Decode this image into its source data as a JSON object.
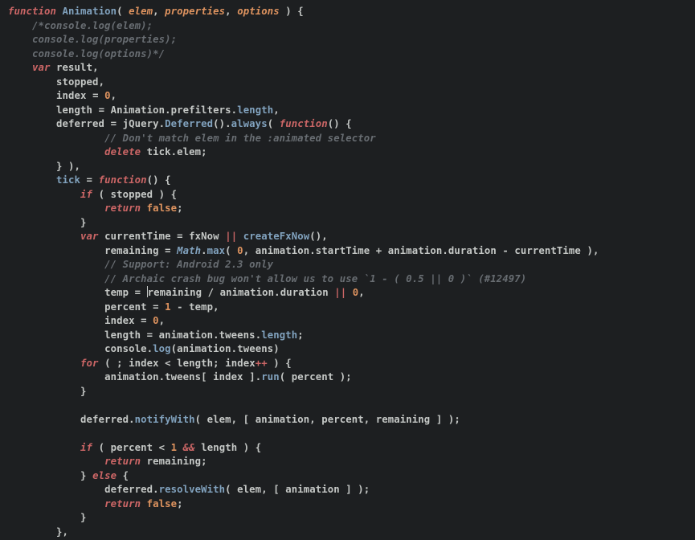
{
  "theme": {
    "background": "#1d1f21",
    "foreground": "#c5c8c6",
    "keyword": "#cc6666",
    "definition": "#81a2be",
    "param": "#de935f",
    "number": "#de935f",
    "comment": "#686d72",
    "builtin": "#81a2be"
  },
  "cursor": {
    "line": 23,
    "column_after_text": "temp = "
  },
  "code_lines": [
    {
      "n": 1,
      "tokens": [
        [
          "kw",
          "function"
        ],
        [
          "punc",
          " "
        ],
        [
          "def",
          "Animation"
        ],
        [
          "punc",
          "( "
        ],
        [
          "param",
          "elem"
        ],
        [
          "punc",
          ", "
        ],
        [
          "param",
          "properties"
        ],
        [
          "punc",
          ", "
        ],
        [
          "param",
          "options"
        ],
        [
          "punc",
          " ) {"
        ]
      ]
    },
    {
      "n": 2,
      "indent": 1,
      "tokens": [
        [
          "comment",
          "/*console.log(elem);"
        ]
      ]
    },
    {
      "n": 3,
      "indent": 1,
      "tokens": [
        [
          "comment",
          "console.log(properties);"
        ]
      ]
    },
    {
      "n": 4,
      "indent": 1,
      "tokens": [
        [
          "comment",
          "console.log(options)*/"
        ]
      ]
    },
    {
      "n": 5,
      "indent": 1,
      "tokens": [
        [
          "kw",
          "var"
        ],
        [
          "punc",
          " "
        ],
        [
          "ident",
          "result"
        ],
        [
          "punc",
          ","
        ]
      ]
    },
    {
      "n": 6,
      "indent": 2,
      "tokens": [
        [
          "ident",
          "stopped"
        ],
        [
          "punc",
          ","
        ]
      ]
    },
    {
      "n": 7,
      "indent": 2,
      "tokens": [
        [
          "ident",
          "index"
        ],
        [
          "punc",
          " = "
        ],
        [
          "num",
          "0"
        ],
        [
          "punc",
          ","
        ]
      ]
    },
    {
      "n": 8,
      "indent": 2,
      "tokens": [
        [
          "ident",
          "length"
        ],
        [
          "punc",
          " = "
        ],
        [
          "ident",
          "Animation"
        ],
        [
          "punc",
          "."
        ],
        [
          "prop",
          "prefilters"
        ],
        [
          "punc",
          "."
        ],
        [
          "def",
          "length"
        ],
        [
          "punc",
          ","
        ]
      ]
    },
    {
      "n": 9,
      "indent": 2,
      "tokens": [
        [
          "ident",
          "deferred"
        ],
        [
          "punc",
          " = "
        ],
        [
          "ident",
          "jQuery"
        ],
        [
          "punc",
          "."
        ],
        [
          "def",
          "Deferred"
        ],
        [
          "punc",
          "()."
        ],
        [
          "def",
          "always"
        ],
        [
          "punc",
          "( "
        ],
        [
          "kw",
          "function"
        ],
        [
          "punc",
          "() {"
        ]
      ]
    },
    {
      "n": 10,
      "indent": 4,
      "tokens": [
        [
          "comment",
          "// Don't match elem in the :animated selector"
        ]
      ]
    },
    {
      "n": 11,
      "indent": 4,
      "tokens": [
        [
          "kw",
          "delete"
        ],
        [
          "punc",
          " "
        ],
        [
          "ident",
          "tick"
        ],
        [
          "punc",
          "."
        ],
        [
          "prop",
          "elem"
        ],
        [
          "punc",
          ";"
        ]
      ]
    },
    {
      "n": 12,
      "indent": 2,
      "tokens": [
        [
          "punc",
          "} ),"
        ]
      ]
    },
    {
      "n": 13,
      "indent": 2,
      "tokens": [
        [
          "def",
          "tick"
        ],
        [
          "punc",
          " = "
        ],
        [
          "kw",
          "function"
        ],
        [
          "punc",
          "() {"
        ]
      ]
    },
    {
      "n": 14,
      "indent": 3,
      "tokens": [
        [
          "kw",
          "if"
        ],
        [
          "punc",
          " ( "
        ],
        [
          "ident",
          "stopped"
        ],
        [
          "punc",
          " ) {"
        ]
      ]
    },
    {
      "n": 15,
      "indent": 4,
      "tokens": [
        [
          "kw",
          "return"
        ],
        [
          "punc",
          " "
        ],
        [
          "bool",
          "false"
        ],
        [
          "punc",
          ";"
        ]
      ]
    },
    {
      "n": 16,
      "indent": 3,
      "tokens": [
        [
          "punc",
          "}"
        ]
      ]
    },
    {
      "n": 17,
      "indent": 3,
      "tokens": [
        [
          "kw",
          "var"
        ],
        [
          "punc",
          " "
        ],
        [
          "ident",
          "currentTime"
        ],
        [
          "punc",
          " = "
        ],
        [
          "ident",
          "fxNow"
        ],
        [
          "punc",
          " "
        ],
        [
          "kw",
          "||"
        ],
        [
          "punc",
          " "
        ],
        [
          "def",
          "createFxNow"
        ],
        [
          "punc",
          "(),"
        ]
      ]
    },
    {
      "n": 18,
      "indent": 4,
      "tokens": [
        [
          "ident",
          "remaining"
        ],
        [
          "punc",
          " = "
        ],
        [
          "builtin",
          "Math"
        ],
        [
          "punc",
          "."
        ],
        [
          "def",
          "max"
        ],
        [
          "punc",
          "( "
        ],
        [
          "num",
          "0"
        ],
        [
          "punc",
          ", "
        ],
        [
          "ident",
          "animation"
        ],
        [
          "punc",
          "."
        ],
        [
          "prop",
          "startTime"
        ],
        [
          "punc",
          " + "
        ],
        [
          "ident",
          "animation"
        ],
        [
          "punc",
          "."
        ],
        [
          "prop",
          "duration"
        ],
        [
          "punc",
          " - "
        ],
        [
          "ident",
          "currentTime"
        ],
        [
          "punc",
          " ),"
        ]
      ]
    },
    {
      "n": 19,
      "indent": 4,
      "tokens": [
        [
          "comment",
          "// Support: Android 2.3 only"
        ]
      ]
    },
    {
      "n": 20,
      "indent": 4,
      "tokens": [
        [
          "comment",
          "// Archaic crash bug won't allow us to use `1 - ( 0.5 || 0 )` (#12497)"
        ]
      ]
    },
    {
      "n": 21,
      "indent": 4,
      "tokens": [
        [
          "ident",
          "temp"
        ],
        [
          "punc",
          " = "
        ],
        [
          "caret",
          ""
        ],
        [
          "ident",
          "remaining"
        ],
        [
          "punc",
          " / "
        ],
        [
          "ident",
          "animation"
        ],
        [
          "punc",
          "."
        ],
        [
          "prop",
          "duration"
        ],
        [
          "punc",
          " "
        ],
        [
          "kw",
          "||"
        ],
        [
          "punc",
          " "
        ],
        [
          "num",
          "0"
        ],
        [
          "punc",
          ","
        ]
      ]
    },
    {
      "n": 22,
      "indent": 4,
      "tokens": [
        [
          "ident",
          "percent"
        ],
        [
          "punc",
          " = "
        ],
        [
          "num",
          "1"
        ],
        [
          "punc",
          " - "
        ],
        [
          "ident",
          "temp"
        ],
        [
          "punc",
          ","
        ]
      ]
    },
    {
      "n": 23,
      "indent": 4,
      "tokens": [
        [
          "ident",
          "index"
        ],
        [
          "punc",
          " = "
        ],
        [
          "num",
          "0"
        ],
        [
          "punc",
          ","
        ]
      ]
    },
    {
      "n": 24,
      "indent": 4,
      "tokens": [
        [
          "ident",
          "length"
        ],
        [
          "punc",
          " = "
        ],
        [
          "ident",
          "animation"
        ],
        [
          "punc",
          "."
        ],
        [
          "prop",
          "tweens"
        ],
        [
          "punc",
          "."
        ],
        [
          "def",
          "length"
        ],
        [
          "punc",
          ";"
        ]
      ]
    },
    {
      "n": 25,
      "indent": 4,
      "tokens": [
        [
          "ident",
          "console"
        ],
        [
          "punc",
          "."
        ],
        [
          "def",
          "log"
        ],
        [
          "punc",
          "("
        ],
        [
          "ident",
          "animation"
        ],
        [
          "punc",
          "."
        ],
        [
          "prop",
          "tweens"
        ],
        [
          "punc",
          ")"
        ]
      ]
    },
    {
      "n": 26,
      "indent": 3,
      "tokens": [
        [
          "kw",
          "for"
        ],
        [
          "punc",
          " ( ; "
        ],
        [
          "ident",
          "index"
        ],
        [
          "punc",
          " < "
        ],
        [
          "ident",
          "length"
        ],
        [
          "punc",
          "; "
        ],
        [
          "ident",
          "index"
        ],
        [
          "kw",
          "++"
        ],
        [
          "punc",
          " ) {"
        ]
      ]
    },
    {
      "n": 27,
      "indent": 4,
      "tokens": [
        [
          "ident",
          "animation"
        ],
        [
          "punc",
          "."
        ],
        [
          "prop",
          "tweens"
        ],
        [
          "punc",
          "[ "
        ],
        [
          "ident",
          "index"
        ],
        [
          "punc",
          " ]."
        ],
        [
          "def",
          "run"
        ],
        [
          "punc",
          "( "
        ],
        [
          "ident",
          "percent"
        ],
        [
          "punc",
          " );"
        ]
      ]
    },
    {
      "n": 28,
      "indent": 3,
      "tokens": [
        [
          "punc",
          "}"
        ]
      ]
    },
    {
      "n": 29,
      "indent": 0,
      "tokens": []
    },
    {
      "n": 30,
      "indent": 3,
      "tokens": [
        [
          "ident",
          "deferred"
        ],
        [
          "punc",
          "."
        ],
        [
          "def",
          "notifyWith"
        ],
        [
          "punc",
          "( "
        ],
        [
          "ident",
          "elem"
        ],
        [
          "punc",
          ", [ "
        ],
        [
          "ident",
          "animation"
        ],
        [
          "punc",
          ", "
        ],
        [
          "ident",
          "percent"
        ],
        [
          "punc",
          ", "
        ],
        [
          "ident",
          "remaining"
        ],
        [
          "punc",
          " ] );"
        ]
      ]
    },
    {
      "n": 31,
      "indent": 0,
      "tokens": []
    },
    {
      "n": 32,
      "indent": 3,
      "tokens": [
        [
          "kw",
          "if"
        ],
        [
          "punc",
          " ( "
        ],
        [
          "ident",
          "percent"
        ],
        [
          "punc",
          " < "
        ],
        [
          "num",
          "1"
        ],
        [
          "punc",
          " "
        ],
        [
          "kw",
          "&&"
        ],
        [
          "punc",
          " "
        ],
        [
          "ident",
          "length"
        ],
        [
          "punc",
          " ) {"
        ]
      ]
    },
    {
      "n": 33,
      "indent": 4,
      "tokens": [
        [
          "kw",
          "return"
        ],
        [
          "punc",
          " "
        ],
        [
          "ident",
          "remaining"
        ],
        [
          "punc",
          ";"
        ]
      ]
    },
    {
      "n": 34,
      "indent": 3,
      "tokens": [
        [
          "punc",
          "} "
        ],
        [
          "kw",
          "else"
        ],
        [
          "punc",
          " {"
        ]
      ]
    },
    {
      "n": 35,
      "indent": 4,
      "tokens": [
        [
          "ident",
          "deferred"
        ],
        [
          "punc",
          "."
        ],
        [
          "def",
          "resolveWith"
        ],
        [
          "punc",
          "( "
        ],
        [
          "ident",
          "elem"
        ],
        [
          "punc",
          ", [ "
        ],
        [
          "ident",
          "animation"
        ],
        [
          "punc",
          " ] );"
        ]
      ]
    },
    {
      "n": 36,
      "indent": 4,
      "tokens": [
        [
          "kw",
          "return"
        ],
        [
          "punc",
          " "
        ],
        [
          "bool",
          "false"
        ],
        [
          "punc",
          ";"
        ]
      ]
    },
    {
      "n": 37,
      "indent": 3,
      "tokens": [
        [
          "punc",
          "}"
        ]
      ]
    },
    {
      "n": 38,
      "indent": 2,
      "tokens": [
        [
          "punc",
          "},"
        ]
      ]
    }
  ]
}
